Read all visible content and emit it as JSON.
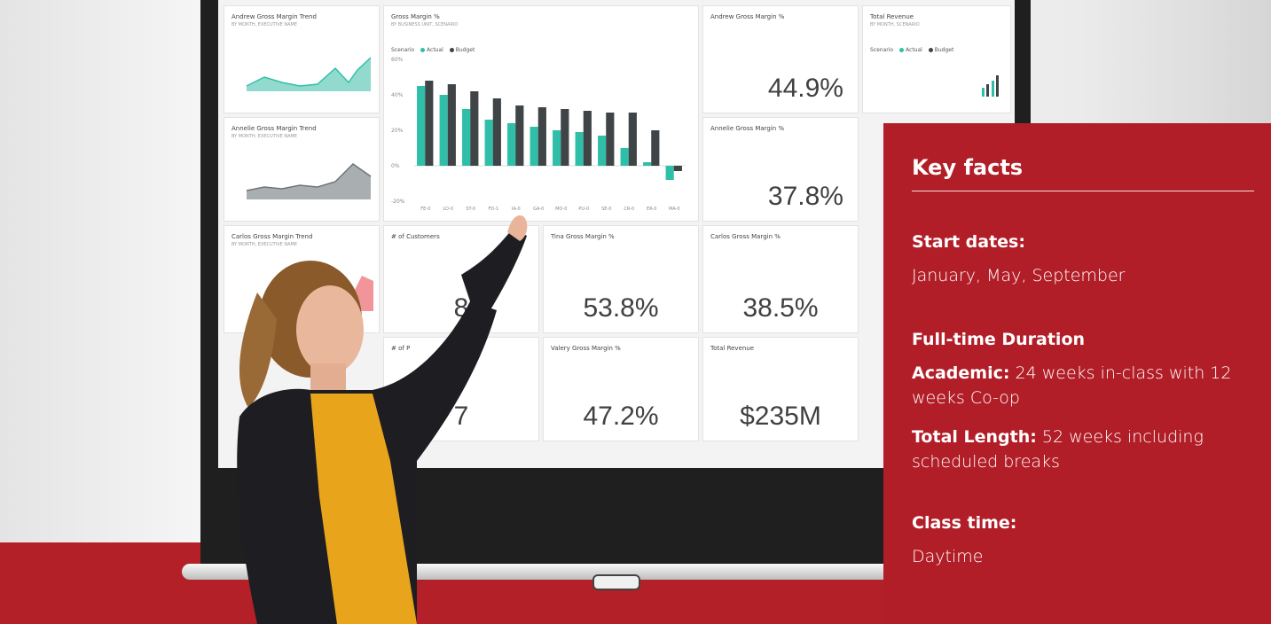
{
  "dashboard": {
    "tiles": {
      "andrew_trend": {
        "title": "Andrew Gross Margin Trend",
        "subtitle": "BY MONTH, EXECUTIVE NAME"
      },
      "gross_margin": {
        "title": "Gross Margin %",
        "subtitle": "BY BUSINESS UNIT, SCENARIO",
        "legend_scenario": "Scenario",
        "legend_actual": "Actual",
        "legend_budget": "Budget"
      },
      "andrew_pct": {
        "title": "Andrew Gross Margin %",
        "value": "44.9%"
      },
      "total_revenue_top": {
        "title": "Total Revenue",
        "subtitle": "BY MONTH, SCENARIO",
        "legend_scenario": "Scenario",
        "legend_actual": "Actual",
        "legend_budget": "Budget"
      },
      "annelie_trend": {
        "title": "Annelie Gross Margin Trend",
        "subtitle": "BY MONTH, EXECUTIVE NAME"
      },
      "annelie_pct": {
        "title": "Annelie Gross Margin %",
        "value": "37.8%"
      },
      "carlos_trend": {
        "title": "Carlos Gross Margin Trend",
        "subtitle": "BY MONTH, EXECUTIVE NAME"
      },
      "customers": {
        "title": "# of Customers",
        "value": "8"
      },
      "tina_pct": {
        "title": "Tina Gross Margin %",
        "value": "53.8%"
      },
      "carlos_pct": {
        "title": "Carlos Gross Margin %",
        "value": "38.5%"
      },
      "products": {
        "title": "# of P",
        "value": "7"
      },
      "valery_pct": {
        "title": "Valery Gross Margin %",
        "value": "47.2%"
      },
      "total_revenue": {
        "title": "Total Revenue",
        "value": "$235M"
      }
    },
    "colors": {
      "actual": "#2fbfa8",
      "budget": "#3f4446",
      "area_teal": "#7fd3c6",
      "area_gray": "#9aa0a3",
      "area_red": "#f08a8f"
    }
  },
  "chart_data": {
    "type": "bar",
    "title": "Gross Margin %",
    "yticks": [
      "60%",
      "40%",
      "20%",
      "0%",
      "-20%"
    ],
    "ylim": [
      -20,
      60
    ],
    "categories": [
      "FE-0",
      "LO-0",
      "ST-0",
      "FD-1",
      "IA-0",
      "GA-0",
      "MO-0",
      "PU-0",
      "SE-0",
      "CR-0",
      "ER-0",
      "MA-0"
    ],
    "series": [
      {
        "name": "Actual",
        "values": [
          45,
          40,
          32,
          26,
          24,
          22,
          20,
          19,
          17,
          10,
          2,
          -8
        ]
      },
      {
        "name": "Budget",
        "values": [
          48,
          46,
          42,
          38,
          34,
          33,
          32,
          31,
          30,
          30,
          20,
          -3
        ]
      }
    ]
  },
  "key_facts": {
    "heading": "Key facts",
    "start_label": "Start dates:",
    "start_value": "January, May, September",
    "duration_label": "Full-time Duration",
    "academic_label": "Academic:",
    "academic_value": "24 weeks in-class with 12 weeks Co-op",
    "total_label": "Total Length:",
    "total_value": "52 weeks including scheduled breaks",
    "class_label": "Class time:",
    "class_value": "Daytime"
  }
}
